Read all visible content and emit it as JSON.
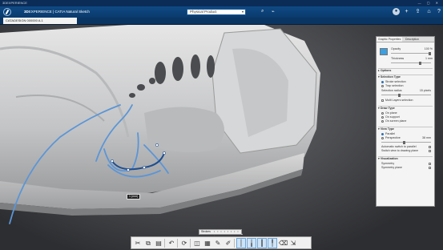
{
  "window": {
    "title": "3DEXPERIENCE",
    "controls": "— ▢ ✕"
  },
  "header": {
    "brand_bold": "3D",
    "brand": "EXPERIENCE | CATIA Natural Sketch",
    "search_value": "Physical Product",
    "search_dropdown_icon": "chevron-down-icon",
    "icons": [
      "search-icon",
      "tag-icon",
      "avatar",
      "plus-icon",
      "share-icon",
      "home-icon",
      "help-icon"
    ]
  },
  "document": {
    "tab_label": "CATADESIGN 000000 A.1"
  },
  "panel": {
    "tabs": [
      "Graphic Properties",
      "Description"
    ],
    "color": "#3c9fe0",
    "opacity_label": "Opacity",
    "opacity_value": "100 %",
    "opacity": 1.0,
    "thickness_label": "Thickness",
    "thickness_value": "1 mm",
    "thickness": 0.75,
    "options_label": "Options",
    "selection_type": {
      "title": "Selection Type",
      "options": [
        {
          "label": "Stroke selection",
          "on": true
        },
        {
          "label": "Trap selection",
          "on": false
        }
      ],
      "radius_label": "Selection radius",
      "radius_value": "15 pixels",
      "radius": 0.35,
      "multi_layers_label": "Multi Layers selection"
    },
    "draw_type": {
      "title": "Draw Type",
      "options": [
        {
          "label": "On plane",
          "on": false
        },
        {
          "label": "On support",
          "on": false
        },
        {
          "label": "On screen plane",
          "on": false
        }
      ]
    },
    "view_type": {
      "title": "View Type",
      "options": [
        {
          "label": "Parallel",
          "on": true
        },
        {
          "label": "Perspective",
          "on": false
        }
      ],
      "perspective_value": "38 mm",
      "perspective": 0.45,
      "auto_switch_label": "Automatic switch to parallel",
      "switch_view_label": "Switch view to drawing plane"
    },
    "visualization": {
      "title": "Visualization",
      "symmetry_label": "Symmetry",
      "symmetry_plane_label": "Symmetry plane"
    }
  },
  "viewport": {
    "point_tag": "1 (mm)"
  },
  "mini_toolbar": {
    "label": "Strokes",
    "dots": "• • • • • • • • •"
  },
  "toolbar": {
    "tools": [
      {
        "name": "cut-icon",
        "glyph": "✂"
      },
      {
        "name": "copy-icon",
        "glyph": "⧉"
      },
      {
        "name": "paste-icon",
        "glyph": "▤"
      },
      {
        "name": "undo-icon",
        "glyph": "↶"
      },
      {
        "name": "update-icon",
        "glyph": "⟳"
      },
      {
        "name": "view-icon",
        "glyph": "◫"
      },
      {
        "name": "layers-icon",
        "glyph": "▦"
      },
      {
        "name": "pen-icon",
        "glyph": "✎"
      },
      {
        "name": "pencil-icon",
        "glyph": "✐"
      },
      {
        "name": "stroke-thin-icon",
        "glyph": "│"
      },
      {
        "name": "stroke-pen-icon",
        "glyph": "╽"
      },
      {
        "name": "stroke-bold-icon",
        "glyph": "┃"
      },
      {
        "name": "brush-icon",
        "glyph": "╿"
      },
      {
        "name": "eraser-icon",
        "glyph": "⌫"
      },
      {
        "name": "select-icon",
        "glyph": "⇲"
      }
    ]
  }
}
